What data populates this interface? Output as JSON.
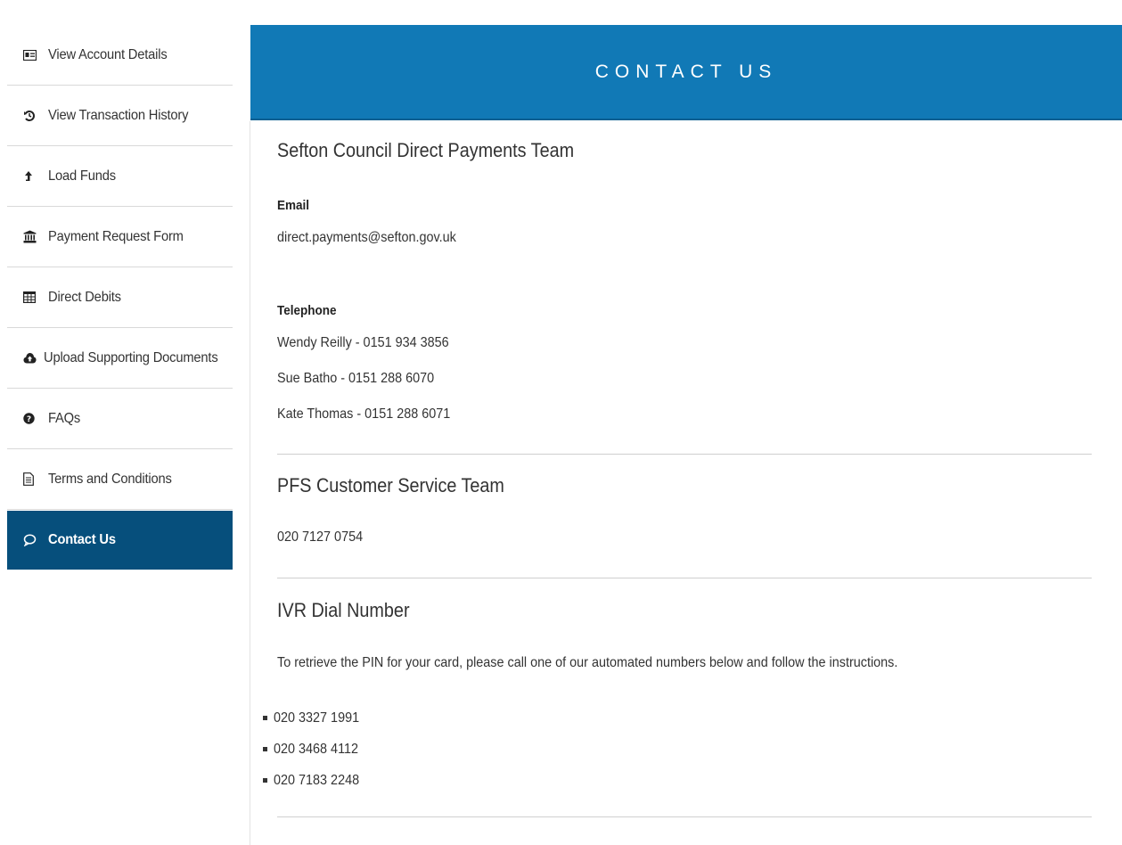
{
  "sidebar": {
    "items": [
      {
        "label": "View Account Details",
        "icon": "id-card-icon",
        "active": false
      },
      {
        "label": "View Transaction History",
        "icon": "history-icon",
        "active": false
      },
      {
        "label": "Load Funds",
        "icon": "upload-arrow-icon",
        "active": false
      },
      {
        "label": "Payment Request Form",
        "icon": "bank-icon",
        "active": false
      },
      {
        "label": "Direct Debits",
        "icon": "table-icon",
        "active": false
      },
      {
        "label": "Upload Supporting Documents",
        "icon": "cloud-upload-icon",
        "active": false
      },
      {
        "label": "FAQs",
        "icon": "question-circle-icon",
        "active": false
      },
      {
        "label": "Terms and Conditions",
        "icon": "document-icon",
        "active": false
      },
      {
        "label": "Contact Us",
        "icon": "chat-bubble-icon",
        "active": true
      }
    ]
  },
  "header": {
    "title": "CONTACT US"
  },
  "council": {
    "title": "Sefton Council Direct Payments Team",
    "email_label": "Email",
    "email": "direct.payments@sefton.gov.uk",
    "telephone_label": "Telephone",
    "phones": [
      "Wendy Reilly - 0151 934 3856",
      "Sue Batho - 0151 288 6070",
      "Kate Thomas - 0151 288 6071"
    ]
  },
  "pfs": {
    "title": "PFS Customer Service Team",
    "phone": "020 7127 0754"
  },
  "ivr": {
    "title": "IVR Dial Number",
    "description": "To retrieve the PIN for your card, please call one of our automated numbers below and follow the instructions.",
    "numbers": [
      "020 3327 1991",
      "020 3468 4112",
      "020 7183 2248"
    ]
  },
  "colors": {
    "banner": "#1179b6",
    "active_nav": "#064f7c"
  }
}
